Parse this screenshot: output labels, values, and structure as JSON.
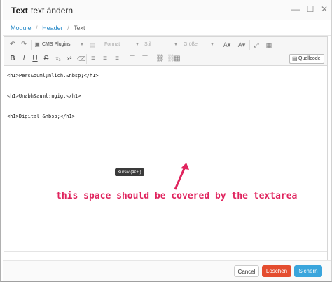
{
  "window": {
    "title_strong": "Text",
    "title_text": "text ändern",
    "minimize_glyph": "—",
    "maximize_glyph": "☐",
    "close_glyph": "✕"
  },
  "breadcrumb": {
    "items": [
      "Module",
      "Header"
    ],
    "current": "Text",
    "separator": "/"
  },
  "toolbar": {
    "undo_icon": "undo-icon",
    "redo_icon": "redo-icon",
    "cms_plugins_label": "CMS Plugins",
    "format_label": "Format",
    "style_label": "Stil",
    "size_label": "Größe",
    "source_label": "Quellcode",
    "bold": "B",
    "italic": "I",
    "underline": "U",
    "strike": "S",
    "subscript": "x₂",
    "superscript": "x²"
  },
  "content": {
    "lines": [
      "<h1>Pers&ouml;nlich.&nbsp;</h1>",
      "<h1>Unabh&auml;ngig.</h1>",
      "<h1>Digital.&nbsp;</h1>"
    ]
  },
  "tooltip": "Kursiv (⌘+I)",
  "annotation": "this space should be covered by the textarea",
  "footer": {
    "cancel_label": "Cancel",
    "delete_label": "Löschen",
    "save_label": "Sichern"
  },
  "colors": {
    "accent": "#2a8bc9",
    "delete": "#e44d2f",
    "save": "#3aa5dc",
    "annotation": "#e0245e"
  }
}
